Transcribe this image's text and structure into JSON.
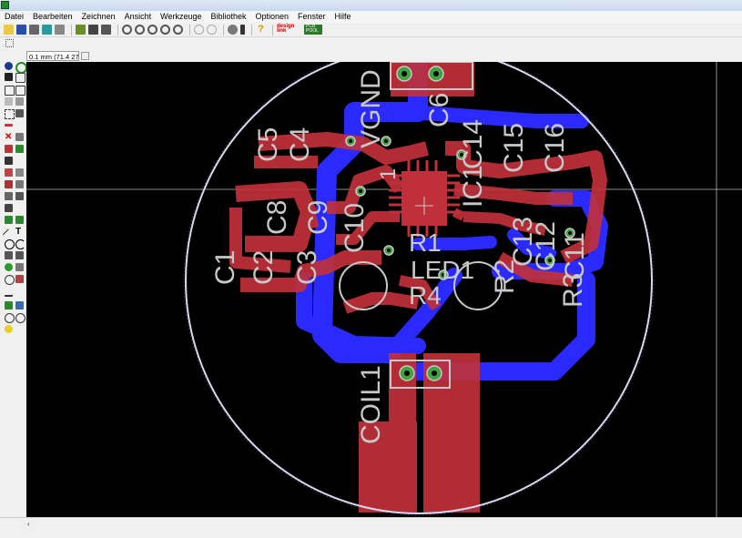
{
  "menu": [
    "Datei",
    "Bearbeiten",
    "Zeichnen",
    "Ansicht",
    "Werkzeuge",
    "Bibliothek",
    "Optionen",
    "Fenster",
    "Hilfe"
  ],
  "coord_display": "0.1 mm (71.4 27.8)",
  "status_text": "‹",
  "toolbar_logos": {
    "left": "design\nlink",
    "right": "PCB\nPOOL"
  },
  "colors": {
    "top_copper": "#c0303a",
    "bottom_copper": "#2a2aff",
    "silk": "#c8c8c8",
    "via": "#3fa33f",
    "board": "#d8d8f0"
  },
  "components": {
    "coil": "COIL1",
    "led": "LED1",
    "ic": "IC1",
    "vgnd": "VGND",
    "caps": [
      "C1",
      "C2",
      "C3",
      "C4",
      "C5",
      "C6",
      "C8",
      "C9",
      "C10",
      "C11",
      "C12",
      "C13",
      "C14",
      "C15",
      "C16"
    ],
    "resistors": [
      "R1",
      "R2",
      "R3",
      "R4"
    ],
    "pin_one": "1"
  },
  "icons": [
    "open-icon",
    "save-icon",
    "print-icon",
    "cam-icon",
    "zoom-in-icon",
    "zoom-out-icon",
    "zoom-fit-icon",
    "undo-icon",
    "redo-icon",
    "stop-icon",
    "help-icon"
  ]
}
